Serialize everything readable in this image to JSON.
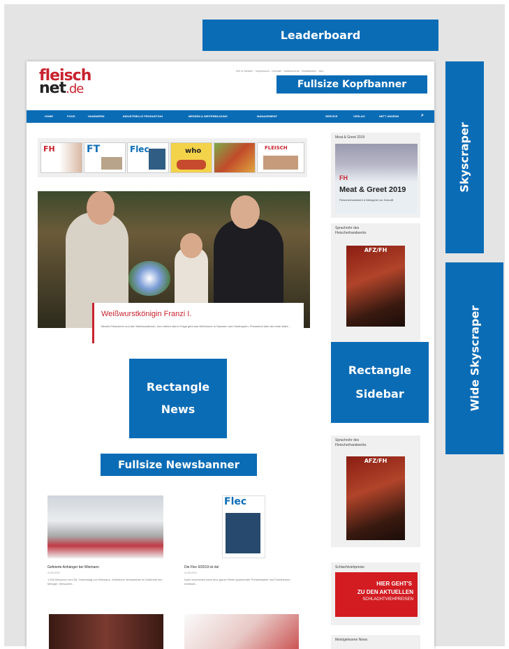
{
  "ads": {
    "leaderboard": "Leaderboard",
    "fullsize_kopfbanner": "Fullsize Kopfbanner",
    "skyscraper": "Skyscraper",
    "wide_skyscraper": "Wide Skyscraper",
    "rectangle_news_line1": "Rectangle",
    "rectangle_news_line2": "News",
    "rectangle_sidebar_line1": "Rectangle",
    "rectangle_sidebar_line2": "Sidebar",
    "fullsize_newsbanner": "Fullsize Newsbanner"
  },
  "site": {
    "logo_line1": "fleisch",
    "logo_line2": "net",
    "logo_suffix": ".de",
    "top_links": "Wir in Medien · Impressum · Kontakt · Datenschutz · Mediadaten · Abo"
  },
  "nav": {
    "items_left": [
      "HOME",
      "FOOD",
      "HANDWERK",
      "INDUSTRIELLE PRODUKTION",
      "MESSEN & WEITERBILDUNG",
      "MANAGEMENT"
    ],
    "items_right": [
      "SERVICE",
      "VERLAG",
      "NETT ANSEHN"
    ],
    "search_icon": "search-icon"
  },
  "covers": [
    "FH",
    "FT",
    "Flec",
    "who",
    "",
    "FLEISCH"
  ],
  "hero": {
    "title": "Weißwurstkönigin Franzi I.",
    "text": "Bereits Fleischerin und den Weißwurstthron: Zum dritten Mal in Folge geht das Weißkrone in Sachsen und Oberbayern. Pressetext über die erste Wahl..."
  },
  "sidebar": {
    "box1_label": "Meat & Greet 2019",
    "box1_ad_brand": "FH",
    "box1_ad_title": "Meat & Greet 2019",
    "box1_ad_text": "Fleischerhandwerk & Metzgerei vor Zukunft",
    "box2_label_line1": "Sprachrohr des",
    "box2_label_line2": "Fleischerhandwerks",
    "box3_label_line1": "Sprachrohr des",
    "box3_label_line2": "Fleischerhandwerks",
    "magazine_title": "AFZ/FH",
    "box4_label": "Schlachtviehpreise",
    "schlacht_line1": "HIER GEHT'S",
    "schlacht_line2": "ZU DEN AKTUELLEN",
    "schlacht_line3": "SCHLACHTVIEHPREISEN",
    "box5_label": "Meistgelesene News"
  },
  "news": [
    {
      "title": "Gefeierte Anhänger bei Wiemann",
      "date": "24.06.2019",
      "text": "1.000 Besucher zum 50. Geburtstag von Wiemann. Zahlreiche Verkaufshits im Sortiment der Metzger. Versuchen..."
    },
    {
      "title": "Die Flec 6/2019 ist da!",
      "date": "24.06.2019",
      "text": "Darin erscheinen kann eine ganze Reihe spannender Preisbeispiele und Fachthemen entdeckt..."
    }
  ],
  "flec_cover_title": "Flec",
  "colors": {
    "accent": "#0b6cb6",
    "brand_red": "#c8222e",
    "background": "#e4e4e4"
  }
}
